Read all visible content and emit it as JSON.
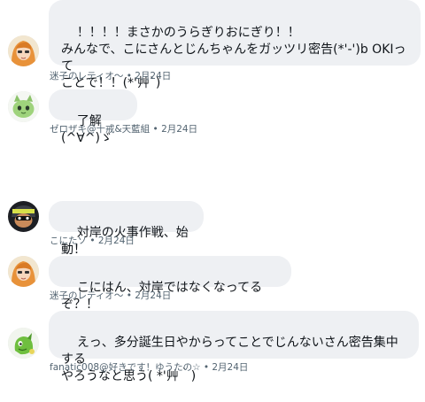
{
  "messages": [
    {
      "text": "！！！！まさかのうらぎりおにぎり！！\nみんなで、こにさんとじんちゃんをガッツリ密告(*'-')b OKIって\nことで！！(*'艸`)",
      "author": "迷子のレティオ〜",
      "date": "2月24日",
      "avatar_icon": "orange-hair-character-avatar-icon"
    },
    {
      "text": "了解(^∀^)ゞ",
      "author": "ゼロザキ@十戒&天藍組",
      "date": "2月24日",
      "avatar_icon": "green-cat-character-avatar-icon"
    },
    {
      "text": "対岸の火事作戦、始動！",
      "author": "こにたソ",
      "date": "2月24日",
      "avatar_icon": "squid-kid-avatar-icon"
    },
    {
      "text": "こにはん、対岸ではなくなってるぞ？！",
      "author": "迷子のレティオ〜",
      "date": "2月24日",
      "avatar_icon": "orange-hair-character-avatar-icon"
    },
    {
      "text": "えっ、多分誕生日やからってことでじんないさん密告集中する\nやろうなと思う( *'艸｀)",
      "author": "fanatic008@好きです！ゆうたの☆",
      "date": "2月24日",
      "avatar_icon": "green-dragon-avatar-icon"
    }
  ],
  "meta_separator": " • "
}
